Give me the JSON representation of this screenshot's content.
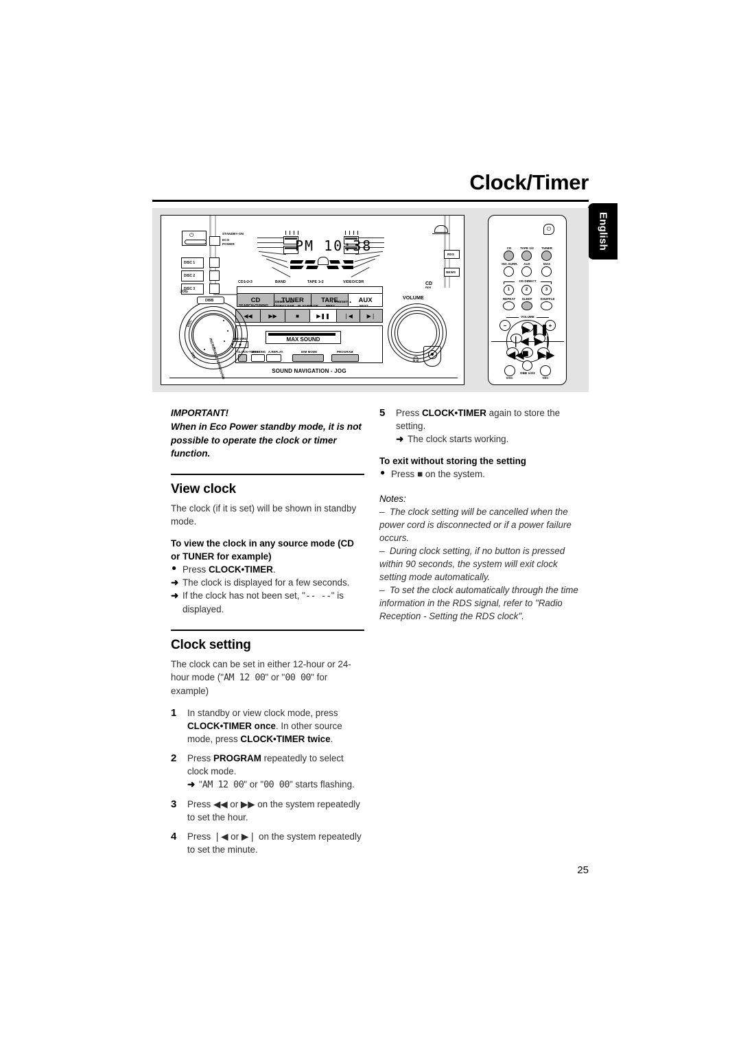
{
  "header": {
    "title": "Clock/Timer",
    "language_tab": "English"
  },
  "page_number": "25",
  "diagram": {
    "name": "audio-system-and-remote-illustration",
    "unit": {
      "standby_label": "STANDBY-ON",
      "eco_power_label_line1": "ECO",
      "eco_power_label_line2": "POWER",
      "power_icon": "⏻",
      "disc_buttons": [
        "DISC 1",
        "DISC 2",
        "DISC 3"
      ],
      "display_text": "PM  10:38",
      "source_top_labels": [
        "CD1•2•3",
        "BAND",
        "TAPE 1•2",
        "VIDEO/CDR"
      ],
      "source_buttons": [
        "CD",
        "TUNER",
        "TAPE",
        "AUX"
      ],
      "transport_top_labels": {
        "search_tuning": "SEARCH•TUNING",
        "demo_stop": "DEMO STOP",
        "stop_clear": "STOP•CLEAR",
        "play_pause": "PLAY•PAUSE",
        "preset": "PRESET",
        "prev": "PREV",
        "next": "NEXT"
      },
      "transport_buttons": [
        "◀◀",
        "▶▶",
        "■",
        "▶❚❚",
        "❘◀",
        "▶❘"
      ],
      "max_sound_label": "MAX SOUND",
      "record_label": "RECORD",
      "bottom_labels": [
        "CLOCK•TIMER",
        "DUBBING",
        "A.REPLAY",
        "DIM MODE",
        "PROGRAM"
      ],
      "sound_navigation_label": "SOUND NAVIGATION - JOG",
      "jog_label": "JOG",
      "jog_ring_labels": [
        "DBB",
        "DSC",
        "VEC",
        "INCREDIBLE SURROUND"
      ],
      "volume_label": "VOLUME",
      "rds_button": "RDS",
      "news_button": "NEWS",
      "cd_rds_logo": "CD RDS",
      "headphone_icon": "headphone-icon"
    },
    "remote": {
      "power_icon": "⏻",
      "row1": [
        "CD",
        "TAPE 1/2",
        "TUNER"
      ],
      "row2": [
        "INC.SURR.",
        "AUX",
        "MAX"
      ],
      "cd_direct_label": "CD DIRECT",
      "cd_direct_numbers": [
        "1",
        "2",
        "3"
      ],
      "row3": [
        "REPEAT",
        "SLEEP",
        "SHUFFLE"
      ],
      "volume_label": "VOLUME",
      "volume_minus": "−",
      "volume_plus": "+",
      "transport": [
        "▶❚❚",
        "❘◀",
        "▶❘",
        "◀◀",
        "■",
        "▶▶"
      ],
      "bottom": [
        "DSC",
        "DBB 1/2/3",
        "VEC"
      ]
    }
  },
  "left_column": {
    "important_title": "IMPORTANT!",
    "important_body": "When in Eco Power standby mode, it is not possible to operate the clock or timer function.",
    "view_clock": {
      "heading": "View clock",
      "intro": "The clock (if it is set) will be shown in standby mode.",
      "subheading": "To view the clock in any source mode (CD or TUNER for example)",
      "bullet": "Press CLOCK•TIMER.",
      "bullet_plain": "Press ",
      "bullet_bold": "CLOCK•TIMER",
      "bullet_tail": ".",
      "result1": "The clock is displayed for a few seconds.",
      "result2_pre": "If the clock has not been set, \"",
      "result2_seg": "-- --",
      "result2_post": "\" is displayed."
    },
    "clock_setting": {
      "heading": "Clock setting",
      "intro_pre": "The clock can be set in either 12-hour or 24-hour mode (\"",
      "intro_seg1": "AM 12 00",
      "intro_mid": "\" or \"",
      "intro_seg2": "00 00",
      "intro_post": "\" for example)",
      "steps": [
        {
          "num": "1",
          "pre": "In standby or view clock mode, press ",
          "bold1": "CLOCK•TIMER once",
          "mid": ". In other source mode, press ",
          "bold2": "CLOCK•TIMER twice",
          "post": "."
        },
        {
          "num": "2",
          "pre": "Press ",
          "bold1": "PROGRAM",
          "mid": " repeatedly to select clock mode.",
          "bold2": "",
          "post": ""
        },
        {
          "num": "3",
          "pre": "Press ◀◀ or ▶▶ on the system repeatedly to set the hour.",
          "bold1": "",
          "mid": "",
          "bold2": "",
          "post": ""
        },
        {
          "num": "4",
          "pre": "Press ❘◀ or ▶❘ on the system repeatedly to set the minute.",
          "bold1": "",
          "mid": "",
          "bold2": "",
          "post": ""
        }
      ],
      "step2_result_pre": "\"",
      "step2_result_seg1": "AM 12 00",
      "step2_result_mid": "\" or \"",
      "step2_result_seg2": "00 00",
      "step2_result_post": "\" starts flashing."
    }
  },
  "right_column": {
    "step5": {
      "num": "5",
      "pre": "Press ",
      "bold": "CLOCK•TIMER",
      "post": " again to store the setting.",
      "result": "The clock starts working."
    },
    "exit_heading": "To exit without storing the setting",
    "exit_bullet_pre": "Press ",
    "exit_bullet_icon": "■",
    "exit_bullet_post": " on the system.",
    "notes_title": "Notes:",
    "notes": [
      "The clock setting will be cancelled when the power cord is disconnected or if a power failure occurs.",
      "During clock setting, if no button is pressed within 90 seconds, the system will exit clock setting mode automatically.",
      "To set the clock automatically through the time information in the RDS signal, refer to \"Radio Reception - Setting the RDS clock\"."
    ]
  }
}
